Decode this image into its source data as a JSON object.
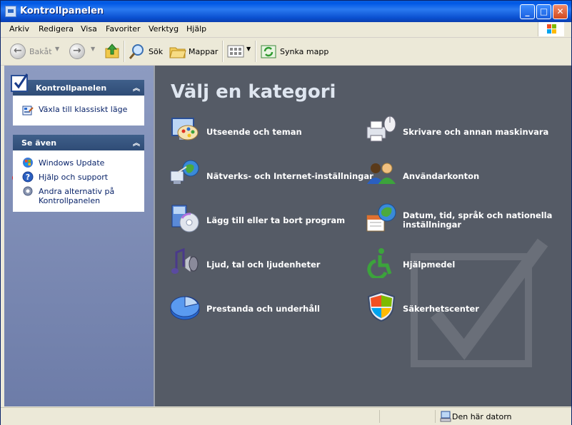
{
  "window": {
    "title": "Kontrollpanelen"
  },
  "menu": [
    "Arkiv",
    "Redigera",
    "Visa",
    "Favoriter",
    "Verktyg",
    "Hjälp"
  ],
  "toolbar": {
    "back": "Bakåt",
    "search": "Sök",
    "folders": "Mappar",
    "sync": "Synka mapp"
  },
  "sidebar": {
    "panel1": {
      "title": "Kontrollpanelen",
      "link": "Växla till klassiskt läge"
    },
    "panel2": {
      "title": "Se även",
      "links": [
        "Windows Update",
        "Hjälp och support",
        "Andra alternativ på",
        "Kontrollpanelen"
      ]
    }
  },
  "main": {
    "heading": "Välj en kategori",
    "categories": [
      {
        "label": "Utseende och teman",
        "icon": "appearance-icon"
      },
      {
        "label": "Skrivare och annan maskinvara",
        "icon": "printer-icon"
      },
      {
        "label": "Nätverks- och Internet-inställningar",
        "icon": "network-icon"
      },
      {
        "label": "Användarkonton",
        "icon": "users-icon"
      },
      {
        "label": "Lägg till eller ta bort program",
        "icon": "add-remove-icon"
      },
      {
        "label_line1": "Datum, tid, språk och nationella",
        "label_line2": "inställningar",
        "icon": "datetime-icon"
      },
      {
        "label": "Ljud, tal och ljudenheter",
        "icon": "sound-icon"
      },
      {
        "label": "Hjälpmedel",
        "icon": "accessibility-icon"
      },
      {
        "label": "Prestanda och underhåll",
        "icon": "performance-icon"
      },
      {
        "label": "Säkerhetscenter",
        "icon": "shield-icon"
      }
    ]
  },
  "status": {
    "text": "Den här datorn"
  },
  "colors": {
    "main_bg": "#555b66",
    "titlebar": "#0058e6",
    "annotation": "#e01010"
  }
}
